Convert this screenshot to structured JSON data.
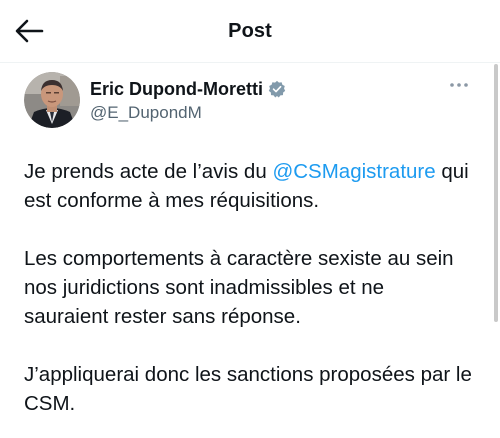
{
  "header": {
    "title": "Post",
    "back_icon": "arrow-left-icon"
  },
  "author": {
    "display_name": "Eric Dupond-Moretti",
    "handle": "@E_DupondM",
    "verified_icon": "verified-badge-icon",
    "verified_color": "#829aab",
    "more_icon": "more-horizontal-icon"
  },
  "post": {
    "p1_before": "Je prends acte de l’avis du ",
    "p1_mention": "@CSMagistrature",
    "p1_after": " qui est conforme à mes réquisitions.",
    "p2": "Les comportements à caractère sexiste au sein nos juridictions sont inadmissibles et ne sauraient rester sans réponse.",
    "p3": "J’appliquerai donc les sanctions proposées par le CSM."
  },
  "colors": {
    "text": "#0f1419",
    "secondary": "#536471",
    "link": "#1d9bf0"
  }
}
